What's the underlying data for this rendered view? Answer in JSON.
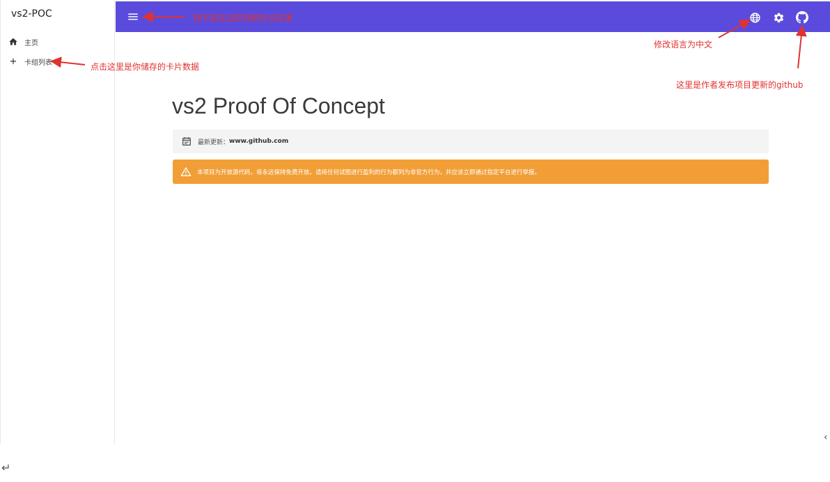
{
  "sidebar": {
    "brand": "vs2-POC",
    "items": [
      {
        "label": "主页",
        "icon": "home-icon"
      },
      {
        "label": "卡组列表",
        "icon": "plus-icon"
      }
    ]
  },
  "topbar": {
    "color": "#5a4bdc",
    "icons": [
      "menu-icon",
      "globe-icon",
      "gear-icon",
      "github-icon"
    ]
  },
  "main": {
    "title": "vs2 Proof Of Concept",
    "update_prefix": "最新更新：",
    "update_link": "www.github.com",
    "warning": "本项目为开放源代码，将永远保持免费开放。请将任何试图进行盈利的行为都列为非官方行为，并应该立即通过指定平台进行举报。"
  },
  "annotations": {
    "menu": "找不到左边的导航栏点这里",
    "deck": "点击这里是你储存的卡片数据",
    "language": "修改语言为中文",
    "github": "这里是作者发布项目更新的github"
  },
  "colors": {
    "warning": "#f29e37",
    "annotation": "#e0322f"
  }
}
